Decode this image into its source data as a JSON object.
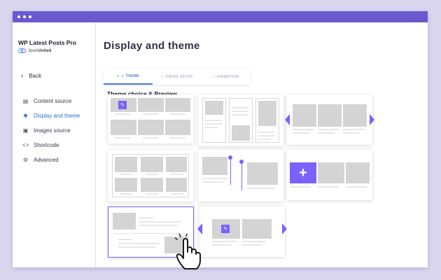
{
  "app": {
    "title": "WP Latest Posts Pro",
    "vendor_prefix": "Joom",
    "vendor_suffix": "United",
    "back_label": "Back"
  },
  "sidebar": {
    "items": [
      {
        "label": "Content source",
        "icon": "content-source-icon"
      },
      {
        "label": "Display and theme",
        "icon": "palette-icon",
        "active": true
      },
      {
        "label": "Images source",
        "icon": "image-icon"
      },
      {
        "label": "Shortcode",
        "icon": "code-icon"
      },
      {
        "label": "Advanced",
        "icon": "settings-icon"
      }
    ]
  },
  "main": {
    "title": "Display and theme",
    "tabs": [
      {
        "label": "✓ ✓ THEME",
        "active": true
      },
      {
        "label": "≡ THEME SETUP"
      },
      {
        "label": "≡ ANIMATION"
      }
    ],
    "section_title": "Theme choice & Preview"
  },
  "colors": {
    "accent": "#7b61ff",
    "titlebar": "#6a5acd",
    "active_link": "#2a6fc9",
    "background": "#d9d6ee"
  },
  "themes": [
    {
      "name": "default-grid",
      "icon": "pin-icon"
    },
    {
      "name": "masonry"
    },
    {
      "name": "slider-carousel"
    },
    {
      "name": "material-grid"
    },
    {
      "name": "timeline"
    },
    {
      "name": "add-carousel",
      "icon": "plus-icon"
    },
    {
      "name": "list-view",
      "selected": true
    },
    {
      "name": "smooth-slider",
      "icon": "pin-icon"
    }
  ]
}
